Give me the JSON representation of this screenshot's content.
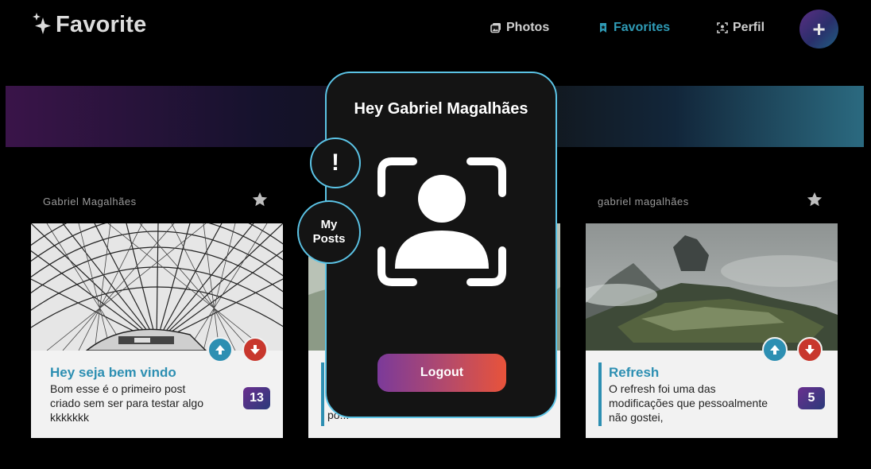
{
  "header": {
    "logo_text": "Favorite",
    "nav": [
      {
        "label": "Photos",
        "icon": "photos-icon"
      },
      {
        "label": "Favorites",
        "icon": "bookmark-icon",
        "active": true
      },
      {
        "label": "Perfil",
        "icon": "profile-scan-icon"
      }
    ],
    "add_label": "+"
  },
  "colors": {
    "accent": "#2d8fb2",
    "modal_border": "#5bc3e5",
    "logout_start": "#7b3a9a",
    "logout_end": "#e8533a",
    "upvote": "#2d8fb2",
    "downvote": "#c8372d"
  },
  "cards": [
    {
      "author": "Gabriel Magalhães",
      "title": "Hey seja bem vindo",
      "text": "Bom esse é o primeiro post criado sem ser para testar algo kkkkkkk",
      "score": "13",
      "image": "glass-dome-ceiling"
    },
    {
      "author": "",
      "title": "",
      "text": "po...",
      "score": "",
      "image": "landscape"
    },
    {
      "author": "gabriel magalhães",
      "title": "Refresh",
      "text": "O refresh foi uma das modificações que pessoalmente não gostei,",
      "score": "5",
      "image": "mountain-ruins"
    }
  ],
  "modal": {
    "greeting": "Hey Gabriel Magalhães",
    "avatar_icon": "user-scan-icon",
    "logout_label": "Logout",
    "alert_label": "!",
    "my_posts_line1": "My",
    "my_posts_line2": "Posts"
  }
}
